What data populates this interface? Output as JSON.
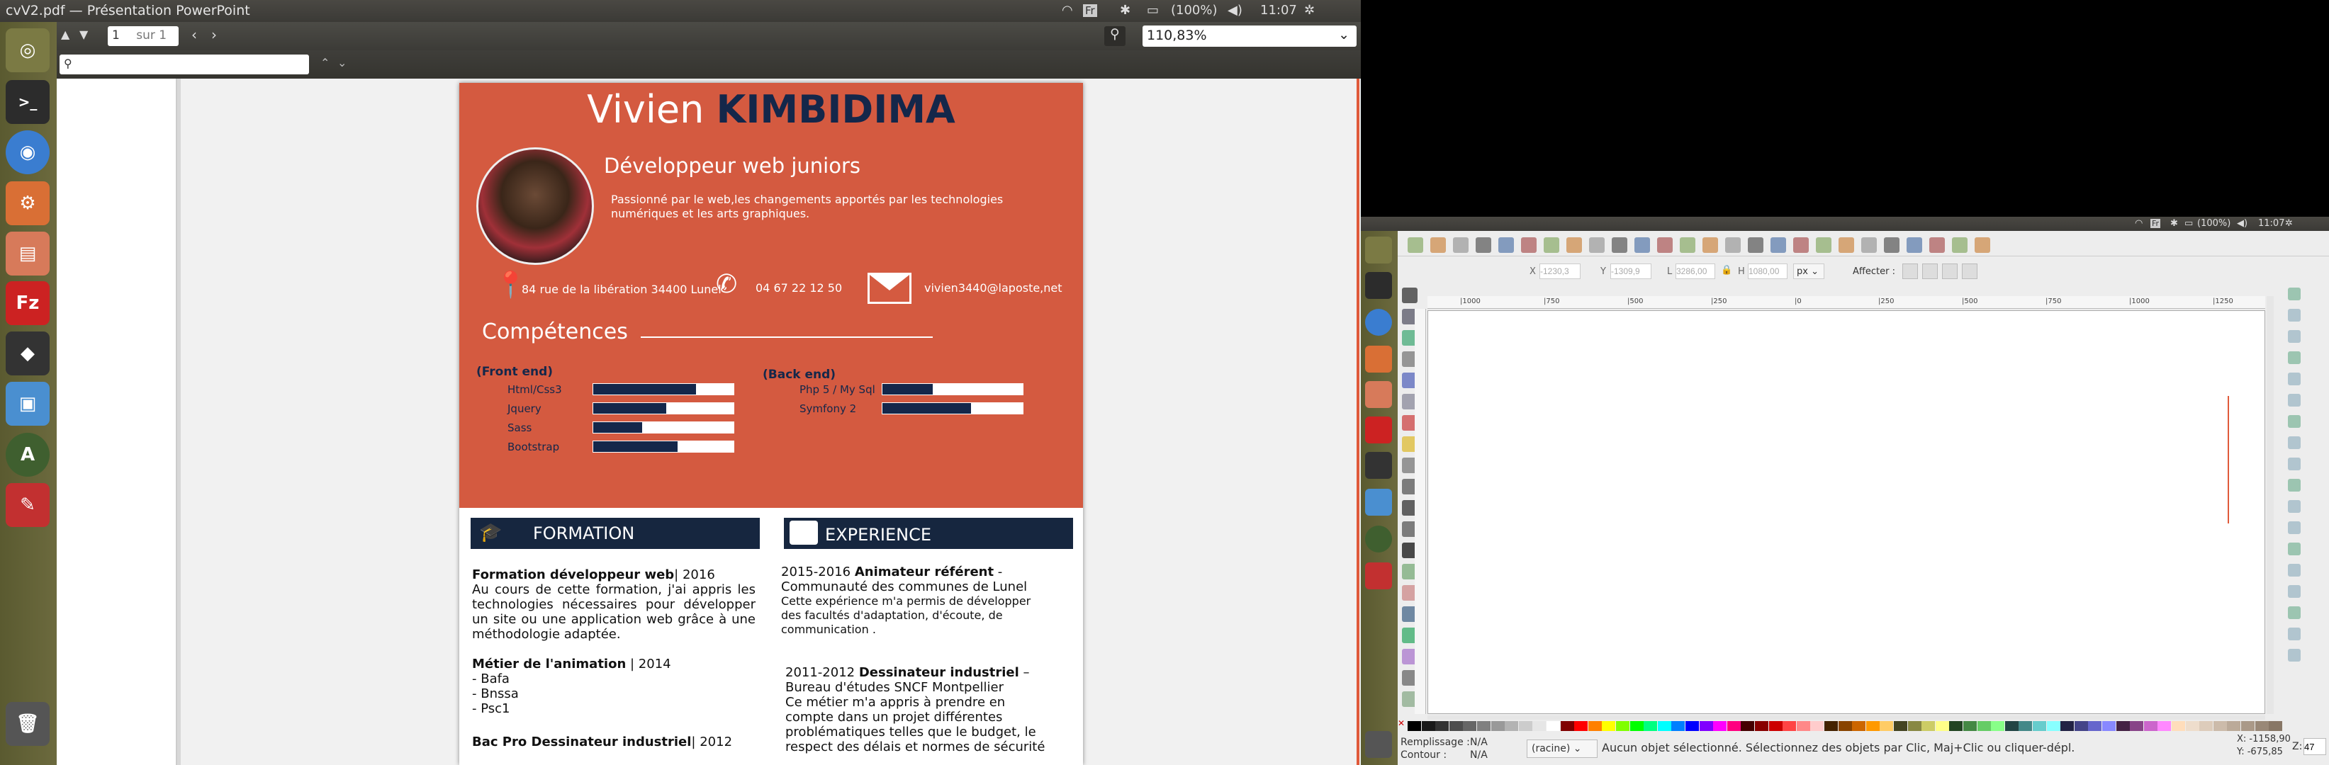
{
  "topbar": {
    "title": "cvV2.pdf — Présentation PowerPoint",
    "lang": "Fr",
    "battery": "(100%)",
    "time": "11:07"
  },
  "doc_toolbar": {
    "page_value": "1",
    "page_of": "sur 1",
    "zoom": "110,83%"
  },
  "search": {
    "placeholder": ""
  },
  "launcher": {
    "icons": [
      "ubuntu-logo-icon",
      "terminal-icon",
      "chromium-icon",
      "settings-icon",
      "file-manager-icon",
      "filezilla-icon",
      "inkscape-icon",
      "virtualbox-icon",
      "software-updater-icon",
      "evince-icon",
      "trash-icon"
    ]
  },
  "cv": {
    "first_name": "Vivien",
    "last_name": "KIMBIDIMA",
    "job_title": "Développeur web juniors",
    "tagline": "Passionné par le web,les changements apportés par les technologies numériques et les arts graphiques.",
    "address": "84 rue de la libération 34400 Lunel",
    "phone": "04 67 22 12 50",
    "email": "vivien3440@laposte,net",
    "skills_title": "Compétences",
    "front_title": "(Front end)",
    "back_title": "(Back end)",
    "front_skills": [
      {
        "name": "Html/Css3",
        "level": 0.73
      },
      {
        "name": "Jquery",
        "level": 0.52
      },
      {
        "name": "Sass",
        "level": 0.35
      },
      {
        "name": "Bootstrap",
        "level": 0.6
      }
    ],
    "back_skills": [
      {
        "name": "Php 5 / My Sql",
        "level": 0.36
      },
      {
        "name": "Symfony 2",
        "level": 0.63
      }
    ],
    "formation_title": "FORMATION",
    "experience_title": "EXPERIENCE",
    "formation": [
      {
        "title": "Formation développeur web",
        "year": "| 2016",
        "body": "Au cours de cette formation, j'ai appris les technologies nécessaires pour développer un site ou une application web grâce à une méthodologie adaptée."
      },
      {
        "title": "Métier de l'animation",
        "year": "| 2014",
        "lines": [
          "- Bafa",
          "- Bnssa",
          "- Psc1"
        ]
      },
      {
        "title": "Bac Pro Dessinateur industriel",
        "year": "|  2012"
      }
    ],
    "experience": [
      {
        "dates": "2015-2016",
        "title": "Animateur référent",
        "sep": " -",
        "place": "Communauté des communes de Lunel",
        "body": "Cette expérience m'a permis de développer des facultés d'adaptation,  d'écoute, de communication ."
      },
      {
        "dates": "2011-2012",
        "title": "Dessinateur industriel",
        "sep": " –",
        "place": "Bureau d'études SNCF Montpellier",
        "body": "Ce métier m'a appris à prendre en compte dans un projet différentes problématiques telles que le budget, le respect des délais et normes de sécurité"
      }
    ]
  },
  "inkscape": {
    "topbar": {
      "lang": "Fr",
      "battery": "(100%)",
      "time": "11:07"
    },
    "x_label": "X",
    "x_value": "-1230,3",
    "y_label": "Y",
    "y_value": "-1309,9",
    "w_label": "L",
    "w_value": "3286,00",
    "h_label": "H",
    "h_value": "1080,00",
    "unit": "px",
    "affect_label": "Affecter :",
    "ruler_ticks": [
      "|1000",
      "|750",
      "|500",
      "|250",
      "|0",
      "|250",
      "|500",
      "|750",
      "|1000",
      "|1250"
    ],
    "fill_label": "Remplissage :",
    "fill_value": "N/A",
    "stroke_label": "Contour :",
    "stroke_value": "N/A",
    "layer": "(racine)",
    "status": "Aucun objet sélectionné. Sélectionnez des objets par Clic, Maj+Clic ou cliquer-dépl.",
    "coord_x": "X: -1158,90",
    "coord_y": "Y:  -675,85",
    "zoom_label": "Z:",
    "zoom_value": "47"
  }
}
